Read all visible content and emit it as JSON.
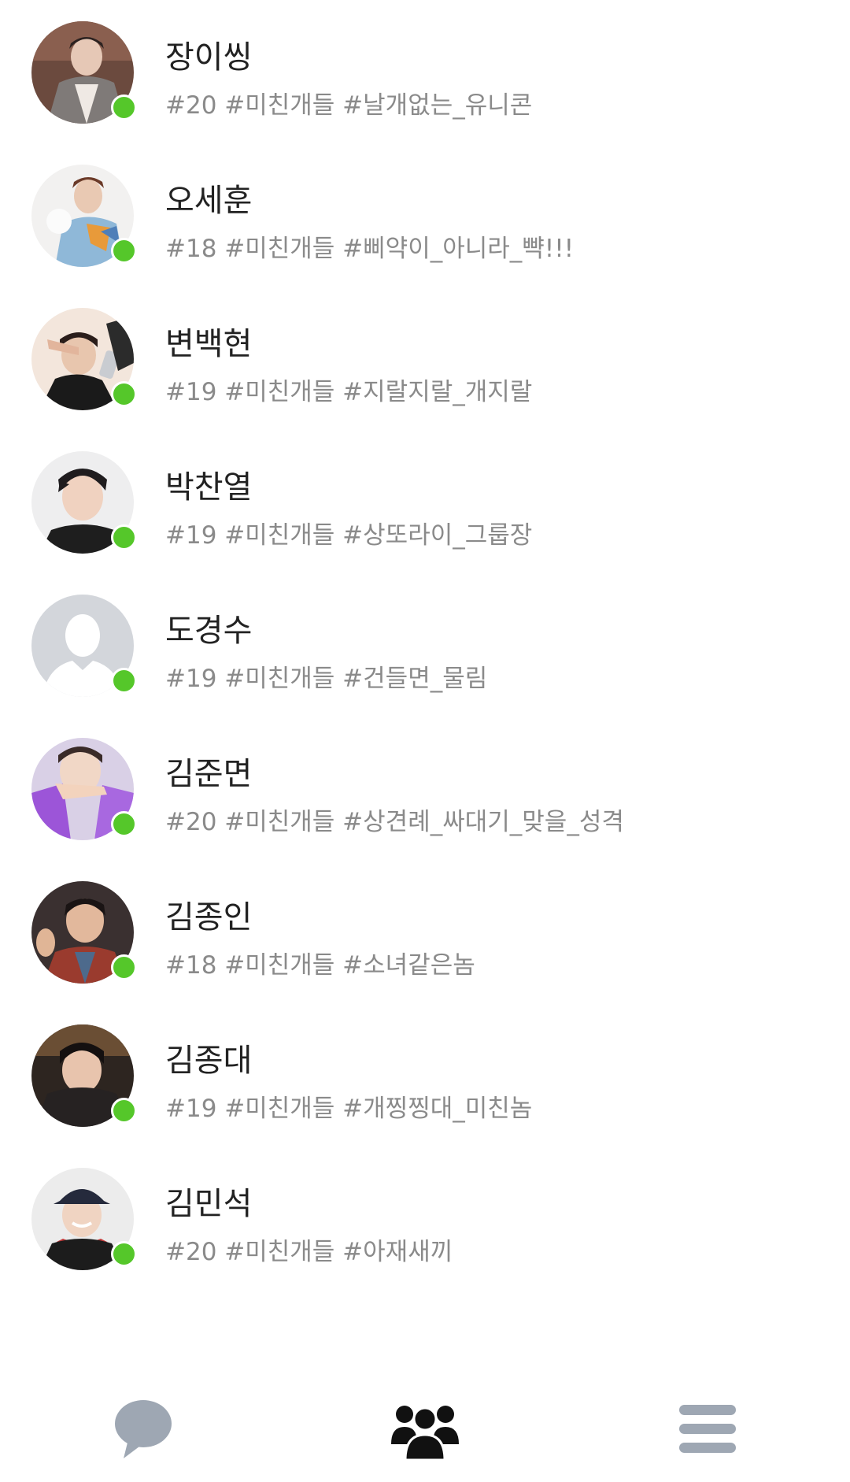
{
  "colors": {
    "online": "#55c72a",
    "name_text": "#222222",
    "status_text": "#8a8a8a",
    "nav_active": "#111111",
    "nav_inactive": "#9ea7b3"
  },
  "friends": [
    {
      "name": "장이씽",
      "status": "#20 #미친개들 #날개없는_유니콘",
      "online": true
    },
    {
      "name": "오세훈",
      "status": "#18 #미친개들 #삐약이_아니라_뺙!!!",
      "online": true
    },
    {
      "name": "변백현",
      "status": "#19 #미친개들 #지랄지랄_개지랄",
      "online": true
    },
    {
      "name": "박찬열",
      "status": "#19 #미친개들 #상또라이_그룹장",
      "online": true
    },
    {
      "name": "도경수",
      "status": "#19 #미친개들 #건들면_물림",
      "online": true
    },
    {
      "name": "김준면",
      "status": "#20 #미친개들 #상견례_싸대기_맞을_성격",
      "online": true
    },
    {
      "name": "김종인",
      "status": "#18 #미친개들 #소녀같은놈",
      "online": true
    },
    {
      "name": "김종대",
      "status": "#19 #미친개들 #개찡찡대_미친놈",
      "online": true
    },
    {
      "name": "김민석",
      "status": "#20 #미친개들 #아재새끼",
      "online": true
    }
  ],
  "bottom_nav": [
    {
      "icon": "chat-bubble-icon",
      "active": false
    },
    {
      "icon": "friends-icon",
      "active": true
    },
    {
      "icon": "menu-icon",
      "active": false
    }
  ]
}
